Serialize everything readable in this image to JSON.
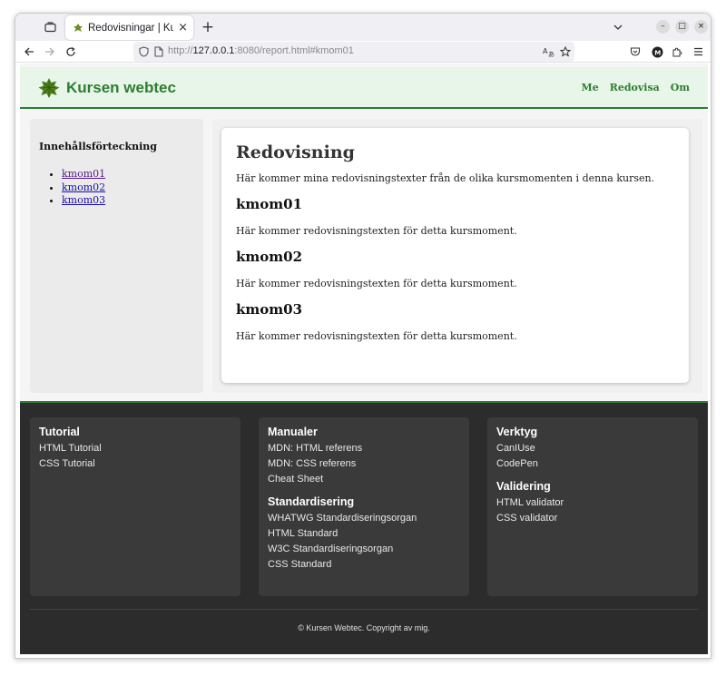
{
  "browser": {
    "tab_title": "Redovisningar | Kursen webtec",
    "tab_close": "×",
    "new_tab": "+",
    "url_prefix": "http://",
    "url_host": "127.0.0.1",
    "url_rest": ":8080/report.html#kmom01",
    "window_buttons": {
      "minimize": "–",
      "maximize": "□",
      "close": "×"
    },
    "icons": [
      "tab-list-icon",
      "chevron-down-icon",
      "back-icon",
      "forward-icon",
      "reload-icon",
      "shield-icon",
      "page-icon",
      "translate-icon",
      "bookmark-star-icon",
      "pocket-icon",
      "account-icon",
      "extensions-icon",
      "menu-icon"
    ]
  },
  "header": {
    "brand": "Kursen webtec",
    "nav": [
      "Me",
      "Redovisa",
      "Om"
    ]
  },
  "sidebar": {
    "title": "Innehållsförteckning",
    "items": [
      "kmom01",
      "kmom02",
      "kmom03"
    ]
  },
  "main": {
    "title": "Redovisning",
    "intro": "Här kommer mina redovisningstexter från de olika kursmomenten i denna kursen.",
    "sections": [
      {
        "heading": "kmom01",
        "text": "Här kommer redovisningstexten för detta kursmoment."
      },
      {
        "heading": "kmom02",
        "text": "Här kommer redovisningstexten för detta kursmoment."
      },
      {
        "heading": "kmom03",
        "text": "Här kommer redovisningstexten för detta kursmoment."
      }
    ]
  },
  "footer": {
    "col1": {
      "title": "Tutorial",
      "links": [
        "HTML Tutorial",
        "CSS Tutorial"
      ]
    },
    "col2": {
      "title": "Manualer",
      "links": [
        "MDN: HTML referens",
        "MDN: CSS referens",
        "Cheat Sheet"
      ],
      "title2": "Standardisering",
      "links2": [
        "WHATWG Standardiseringsorgan",
        "HTML Standard",
        "W3C Standardiseringsorgan",
        "CSS Standard"
      ]
    },
    "col3": {
      "title": "Verktyg",
      "links": [
        "CanIUse",
        "CodePen"
      ],
      "title2": "Validering",
      "links2": [
        "HTML validator",
        "CSS validator"
      ]
    },
    "copyright": "© Kursen Webtec. Copyright av mig."
  },
  "colors": {
    "accent": "#2e7d32",
    "header_bg": "#e8f5e9",
    "footer_bg": "#2c2c2c",
    "footer_card": "#3a3a3a"
  }
}
